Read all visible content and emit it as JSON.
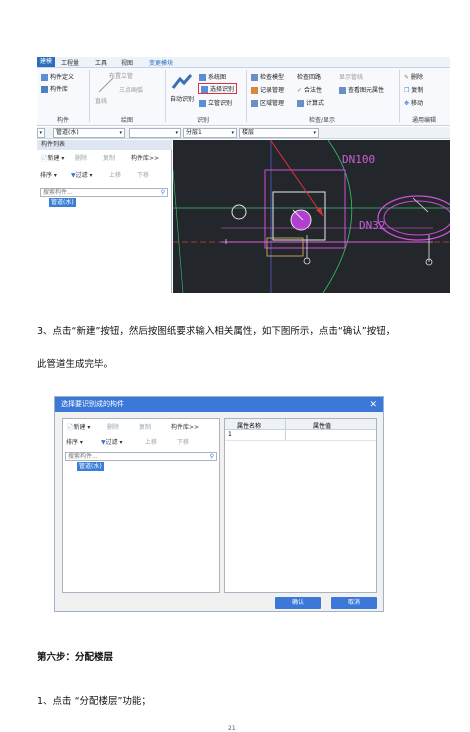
{
  "screenshot1": {
    "tabs": [
      "建模",
      "工程量",
      "工具",
      "视图",
      "变更模块"
    ],
    "ribbon": {
      "component_items": [
        "构件定义",
        "构件库"
      ],
      "draw_items": [
        "布置立管",
        "直线",
        "三点画弧"
      ],
      "recognize_items": [
        "自动识别",
        "系统图",
        "选择识别",
        "立管识别"
      ],
      "check_items": [
        "检查模型",
        "检查回路",
        "显示管线",
        "记录管理",
        "合法性",
        "查看图元属性",
        "区域管理",
        "计算式"
      ],
      "edit_items": [
        "删除",
        "复制",
        "移动"
      ],
      "groups": [
        "构件",
        "绘图",
        "识别",
        "检查/显示",
        "通用编辑"
      ]
    },
    "selectors": [
      "管道(水)",
      "分层1",
      "楼层"
    ],
    "panel": {
      "title": "构件列表",
      "toolbar1": [
        "新建",
        "删除",
        "复制",
        "构件库>>"
      ],
      "toolbar2": [
        "排序",
        "过滤",
        "上移",
        "下移"
      ],
      "search_placeholder": "搜索构件...",
      "tree_item": "管道(水)"
    },
    "cad_labels": [
      "DN100",
      "DN32"
    ]
  },
  "paragraph1_line1": "3、点击“新建”按钮，然后按图纸要求输入相关属性，如下图所示，点击“确认”按钮，",
  "paragraph1_line2": "此管道生成完毕。",
  "dialog": {
    "title": "选择要识别成的构件",
    "toolbar1": [
      "新建",
      "删除",
      "复制",
      "构件库>>"
    ],
    "toolbar2": [
      "排序",
      "过滤",
      "上移",
      "下移"
    ],
    "search_placeholder": "搜索构件...",
    "tree_item": "管道(水)",
    "table_headers": [
      "属性名称",
      "属性值"
    ],
    "row_number": "1",
    "confirm": "确认",
    "cancel": "取消"
  },
  "step_heading": "第六步：分配楼层",
  "step_line": "1、点击 “分配楼层”功能；",
  "page_number": "21",
  "colors": {
    "accent": "#3b78d8",
    "cad_bg": "#23262b",
    "highlight": "#e0303a"
  }
}
